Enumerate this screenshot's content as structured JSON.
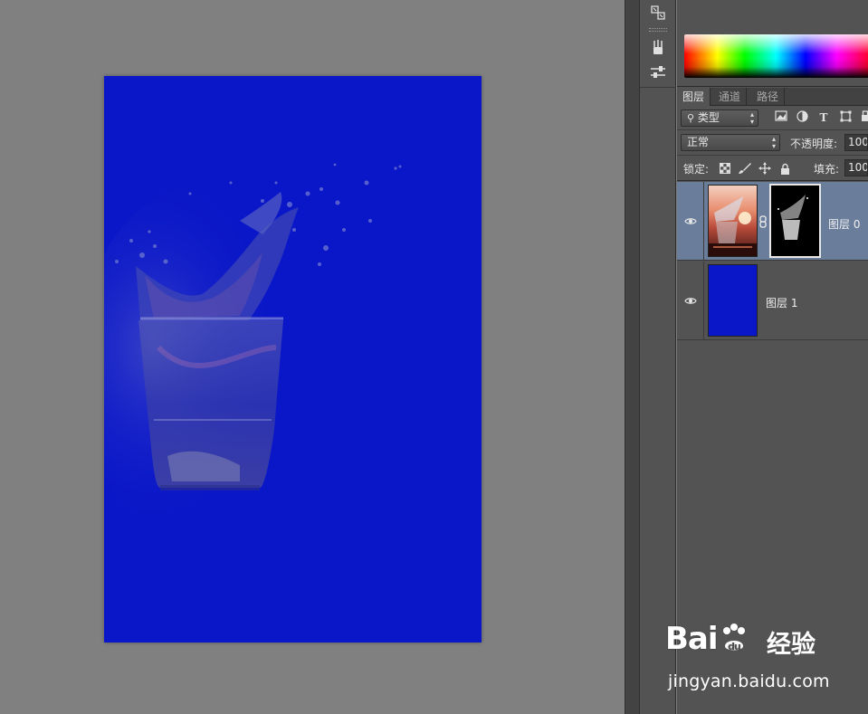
{
  "panel_tabs": {
    "layers": "图层",
    "channels": "通道",
    "paths": "路径"
  },
  "filter": {
    "kind_label": "类型"
  },
  "blend": {
    "mode": "正常",
    "opacity_label": "不透明度:",
    "opacity_value": "100"
  },
  "lock": {
    "label": "锁定:",
    "fill_label": "填充:",
    "fill_value": "100"
  },
  "layers": [
    {
      "name": "图层 0",
      "selected": true,
      "has_mask": true
    },
    {
      "name": "图层 1",
      "selected": false,
      "fill_color": "#0a17c8"
    }
  ],
  "watermark": {
    "brand": "Bai",
    "brand_suffix": "du",
    "cn": "经验",
    "url": "jingyan.baidu.com"
  },
  "colors": {
    "document_bg": "#0a17c8",
    "selection": "#6a7d9b",
    "panel_bg": "#535353"
  }
}
